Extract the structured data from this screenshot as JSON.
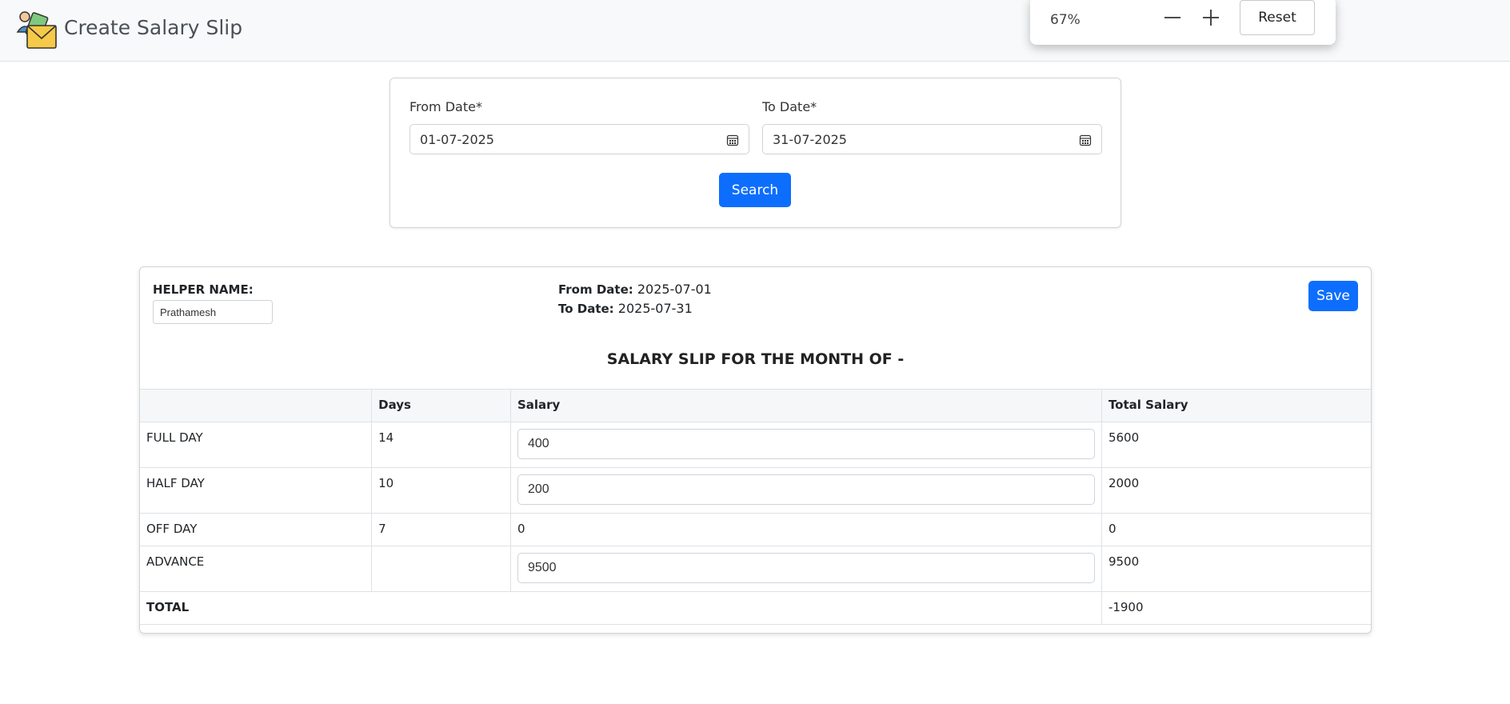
{
  "header": {
    "title": "Create Salary Slip"
  },
  "zoom": {
    "level": "67%",
    "reset_label": "Reset"
  },
  "search": {
    "from_label": "From Date*",
    "from_value": "01-07-2025",
    "to_label": "To Date*",
    "to_value": "31-07-2025",
    "button_label": "Search"
  },
  "slip": {
    "helper_label": "HELPER NAME:",
    "helper_value": "Prathamesh",
    "from_label": "From Date:",
    "from_value": "2025-07-01",
    "to_label": "To Date:",
    "to_value": "2025-07-31",
    "save_label": "Save",
    "title": "SALARY SLIP FOR THE MONTH OF -",
    "columns": [
      "",
      "Days",
      "Salary",
      "Total Salary"
    ],
    "rows": [
      {
        "label": "FULL DAY",
        "days": "14",
        "salary": "400",
        "total": "5600"
      },
      {
        "label": "HALF DAY",
        "days": "10",
        "salary": "200",
        "total": "2000"
      },
      {
        "label": "OFF DAY",
        "days": "7",
        "salary": "0",
        "total": "0"
      },
      {
        "label": "ADVANCE",
        "days": "",
        "salary": "9500",
        "total": "9500"
      }
    ],
    "total_label": "TOTAL",
    "total_value": "-1900"
  }
}
